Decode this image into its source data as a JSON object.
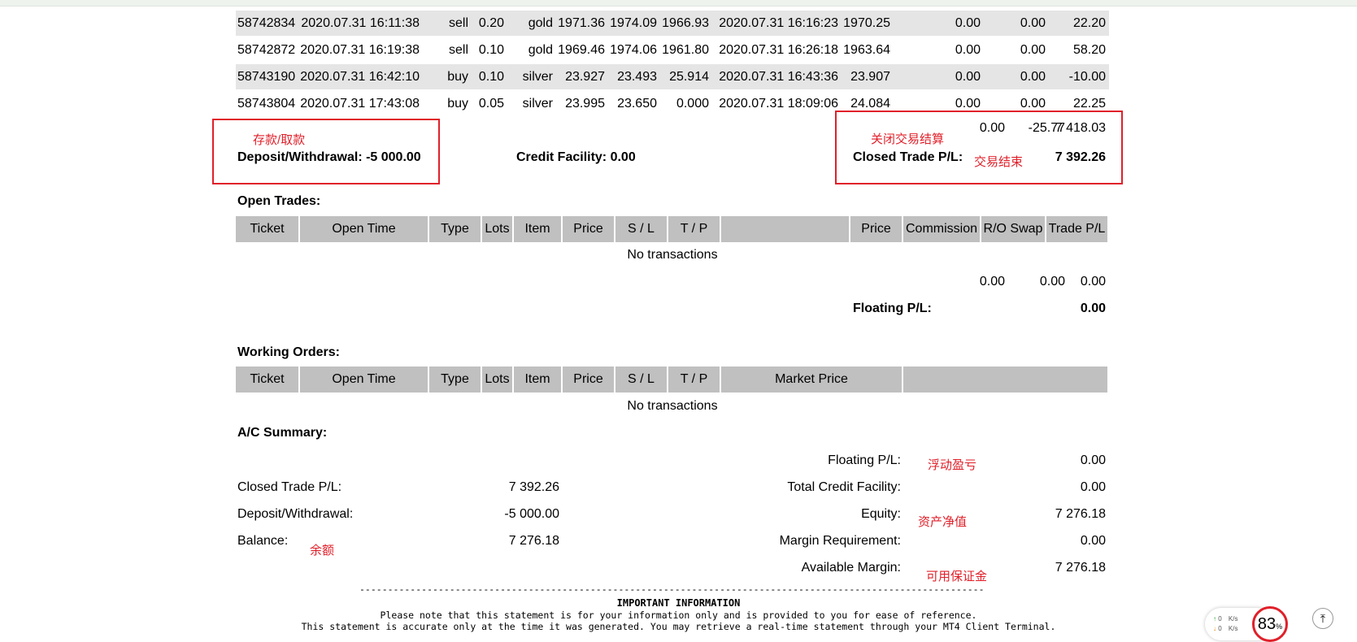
{
  "closed_rows": [
    {
      "ticket": "58742834",
      "open_time": "2020.07.31 16:11:38",
      "type": "sell",
      "lots": "0.20",
      "item": "gold",
      "price": "1971.36",
      "sl": "1974.09",
      "tp": "1966.93",
      "close_time": "2020.07.31 16:16:23",
      "close_price": "1970.25",
      "commission": "0.00",
      "swap": "0.00",
      "pl": "22.20"
    },
    {
      "ticket": "58742872",
      "open_time": "2020.07.31 16:19:38",
      "type": "sell",
      "lots": "0.10",
      "item": "gold",
      "price": "1969.46",
      "sl": "1974.06",
      "tp": "1961.80",
      "close_time": "2020.07.31 16:26:18",
      "close_price": "1963.64",
      "commission": "0.00",
      "swap": "0.00",
      "pl": "58.20"
    },
    {
      "ticket": "58743190",
      "open_time": "2020.07.31 16:42:10",
      "type": "buy",
      "lots": "0.10",
      "item": "silver",
      "price": "23.927",
      "sl": "23.493",
      "tp": "25.914",
      "close_time": "2020.07.31 16:43:36",
      "close_price": "23.907",
      "commission": "0.00",
      "swap": "0.00",
      "pl": "-10.00"
    },
    {
      "ticket": "58743804",
      "open_time": "2020.07.31 17:43:08",
      "type": "buy",
      "lots": "0.05",
      "item": "silver",
      "price": "23.995",
      "sl": "23.650",
      "tp": "0.000",
      "close_time": "2020.07.31 18:09:06",
      "close_price": "24.084",
      "commission": "0.00",
      "swap": "0.00",
      "pl": "22.25"
    }
  ],
  "closed_totals": {
    "commission": "0.00",
    "swap": "-25.77",
    "pl": "7 418.03"
  },
  "deposit_line": "Deposit/Withdrawal: -5 000.00",
  "credit_line": "Credit Facility: 0.00",
  "closed_pl_label": "Closed Trade P/L:",
  "closed_pl_value": "7 392.26",
  "annotations": {
    "deposit": "存款/取款",
    "closed_close": "关闭交易结算",
    "trade_end": "交易结束",
    "floating": "浮动盈亏",
    "equity": "资产净值",
    "balance": "余额",
    "available": "可用保证金"
  },
  "open_trades": {
    "title": "Open Trades:",
    "headers": [
      "Ticket",
      "Open Time",
      "Type",
      "Lots",
      "Item",
      "Price",
      "S / L",
      "T / P",
      "",
      "Price",
      "Commission",
      "R/O Swap",
      "Trade P/L"
    ],
    "empty": "No transactions",
    "totals": {
      "commission": "0.00",
      "swap": "0.00",
      "pl": "0.00"
    },
    "floating_label": "Floating P/L:",
    "floating_value": "0.00"
  },
  "working_orders": {
    "title": "Working Orders:",
    "headers": [
      "Ticket",
      "Open Time",
      "Type",
      "Lots",
      "Item",
      "Price",
      "S / L",
      "T / P",
      "Market Price",
      ""
    ],
    "empty": "No transactions"
  },
  "summary": {
    "title": "A/C Summary:",
    "left": [
      {
        "label": "Closed Trade P/L:",
        "value": "7 392.26"
      },
      {
        "label": "Deposit/Withdrawal:",
        "value": "-5 000.00"
      },
      {
        "label": "Balance:",
        "value": "7 276.18"
      }
    ],
    "right": [
      {
        "label": "Floating P/L:",
        "value": "0.00"
      },
      {
        "label": "Total Credit Facility:",
        "value": "0.00"
      },
      {
        "label": "Equity:",
        "value": "7 276.18"
      },
      {
        "label": "Margin Requirement:",
        "value": "0.00"
      },
      {
        "label": "Available Margin:",
        "value": "7 276.18"
      }
    ]
  },
  "important": {
    "dashes": "-------------------------------------------------------------------------------------------------------------------------------",
    "title": "IMPORTANT INFORMATION",
    "line1": "Please note that this statement is for your information only and is provided to you for ease of reference.",
    "line2": "This statement is accurate only at the time it was generated. You may retrieve a real-time statement through your MT4 Client Terminal."
  },
  "widget": {
    "up": "0",
    "down": "0",
    "unit": "K/s",
    "percent": "83",
    "percent_sign": "%"
  },
  "colors": {
    "accent_red": "#e0202a",
    "row_gray": "#e5e5e5",
    "header_gray": "#c0c0c0"
  }
}
